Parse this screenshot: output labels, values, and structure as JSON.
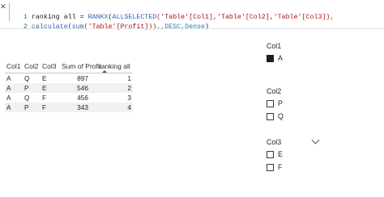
{
  "formula": {
    "line1_number": "1",
    "line1_prefix": "ranking all = ",
    "line1_fn": "RANKX",
    "line1_open": "(",
    "line1_fn2": "ALLSELECTED",
    "line1_args": "('Table'[Col1],'Table'[Col2],'Table'[Col3]),",
    "line2_number": "2",
    "line2_fn": "calculate",
    "line2_mid": "(",
    "line2_fn2": "sum",
    "line2_args": "('Table'[Profit])),,",
    "line2_desc": "DESC",
    "line2_comma": ",",
    "line2_dense": "Dense",
    "line2_close": ")"
  },
  "table": {
    "headers": [
      "Col1",
      "Col2",
      "Col3",
      "Sum of Profit",
      "ranking all"
    ],
    "rows": [
      [
        "A",
        "Q",
        "E",
        "897",
        "1"
      ],
      [
        "A",
        "P",
        "E",
        "546",
        "2"
      ],
      [
        "A",
        "Q",
        "F",
        "456",
        "3"
      ],
      [
        "A",
        "P",
        "F",
        "343",
        "4"
      ]
    ]
  },
  "slicers": [
    {
      "title": "Col1",
      "items": [
        {
          "label": "A",
          "checked": true
        }
      ]
    },
    {
      "title": "Col2",
      "items": [
        {
          "label": "P",
          "checked": false
        },
        {
          "label": "Q",
          "checked": false
        }
      ]
    },
    {
      "title": "Col3",
      "items": [
        {
          "label": "E",
          "checked": false
        },
        {
          "label": "F",
          "checked": false
        }
      ]
    }
  ]
}
